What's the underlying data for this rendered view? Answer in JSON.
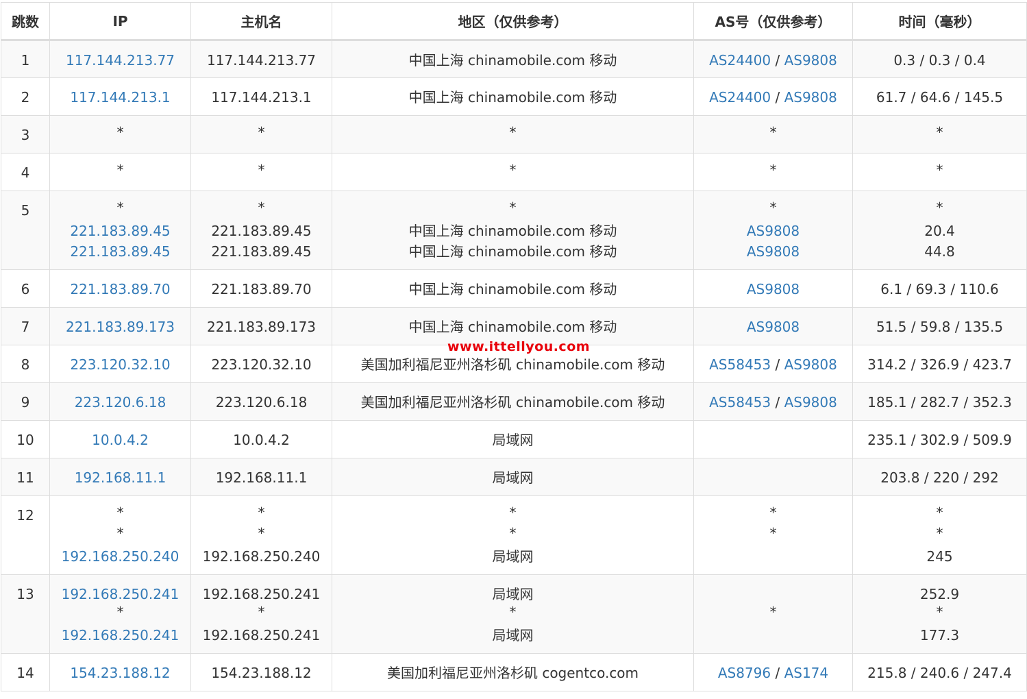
{
  "headers": [
    "跳数",
    "IP",
    "主机名",
    "地区（仅供参考）",
    "AS号（仅供参考）",
    "时间（毫秒）"
  ],
  "rows": [
    {
      "hop": "1",
      "lines": [
        {
          "ip": "117.144.213.77",
          "host": "117.144.213.77",
          "region": "中国上海 chinamobile.com 移动",
          "as": [
            "AS24400",
            "AS9808"
          ],
          "time": "0.3 / 0.3 / 0.4"
        }
      ]
    },
    {
      "hop": "2",
      "lines": [
        {
          "ip": "117.144.213.1",
          "host": "117.144.213.1",
          "region": "中国上海 chinamobile.com 移动",
          "as": [
            "AS24400",
            "AS9808"
          ],
          "time": "61.7 / 64.6 / 145.5"
        }
      ]
    },
    {
      "hop": "3",
      "lines": [
        {
          "ip": "*",
          "host": "*",
          "region": "*",
          "as": [
            "*"
          ],
          "time": "*"
        }
      ]
    },
    {
      "hop": "4",
      "lines": [
        {
          "ip": "*",
          "host": "*",
          "region": "*",
          "as": [
            "*"
          ],
          "time": "*"
        }
      ]
    },
    {
      "hop": "5",
      "lines": [
        {
          "ip": "*",
          "host": "*",
          "region": "*",
          "as": [
            "*"
          ],
          "time": "*"
        },
        {
          "ip": "221.183.89.45",
          "host": "221.183.89.45",
          "region": "中国上海 chinamobile.com 移动",
          "as": [
            "AS9808"
          ],
          "time": "20.4"
        },
        {
          "ip": "221.183.89.45",
          "host": "221.183.89.45",
          "region": "中国上海 chinamobile.com 移动",
          "as": [
            "AS9808"
          ],
          "time": "44.8"
        }
      ]
    },
    {
      "hop": "6",
      "lines": [
        {
          "ip": "221.183.89.70",
          "host": "221.183.89.70",
          "region": "中国上海 chinamobile.com 移动",
          "as": [
            "AS9808"
          ],
          "time": "6.1 / 69.3 / 110.6"
        }
      ]
    },
    {
      "hop": "7",
      "lines": [
        {
          "ip": "221.183.89.173",
          "host": "221.183.89.173",
          "region": "中国上海 chinamobile.com 移动",
          "as": [
            "AS9808"
          ],
          "time": "51.5 / 59.8 / 135.5"
        }
      ]
    },
    {
      "hop": "8",
      "lines": [
        {
          "ip": "223.120.32.10",
          "host": "223.120.32.10",
          "region": "美国加利福尼亚州洛杉矶 chinamobile.com 移动",
          "as": [
            "AS58453",
            "AS9808"
          ],
          "time": "314.2 / 326.9 / 423.7"
        }
      ]
    },
    {
      "hop": "9",
      "lines": [
        {
          "ip": "223.120.6.18",
          "host": "223.120.6.18",
          "region": "美国加利福尼亚州洛杉矶 chinamobile.com 移动",
          "as": [
            "AS58453",
            "AS9808"
          ],
          "time": "185.1 / 282.7 / 352.3"
        }
      ]
    },
    {
      "hop": "10",
      "lines": [
        {
          "ip": "10.0.4.2",
          "host": "10.0.4.2",
          "region": "局域网",
          "as": [],
          "time": "235.1 / 302.9 / 509.9"
        }
      ]
    },
    {
      "hop": "11",
      "lines": [
        {
          "ip": "192.168.11.1",
          "host": "192.168.11.1",
          "region": "局域网",
          "as": [],
          "time": "203.8 / 220 / 292"
        }
      ]
    },
    {
      "hop": "12",
      "lines": [
        {
          "ip": "*",
          "host": "*",
          "region": "*",
          "as": [
            "*"
          ],
          "time": "*"
        },
        {
          "ip": "*",
          "host": "*",
          "region": "*",
          "as": [
            "*"
          ],
          "time": "*"
        },
        {
          "ip": "192.168.250.240",
          "host": "192.168.250.240",
          "region": "局域网",
          "as": [],
          "time": "245"
        }
      ]
    },
    {
      "hop": "13",
      "lines": [
        {
          "ip": "192.168.250.241",
          "host": "192.168.250.241",
          "region": "局域网",
          "as": [],
          "time": "252.9"
        },
        {
          "ip": "*",
          "host": "*",
          "region": "*",
          "as": [
            "*"
          ],
          "time": "*"
        },
        {
          "ip": "192.168.250.241",
          "host": "192.168.250.241",
          "region": "局域网",
          "as": [],
          "time": "177.3"
        }
      ]
    },
    {
      "hop": "14",
      "lines": [
        {
          "ip": "154.23.188.12",
          "host": "154.23.188.12",
          "region": "美国加利福尼亚州洛杉矶 cogentco.com",
          "as": [
            "AS8796",
            "AS174"
          ],
          "time": "215.8 / 240.6 / 247.4"
        }
      ]
    }
  ],
  "as_separator": " / ",
  "watermark": "www.ittellyou.com",
  "colors": {
    "link": "#337ab7",
    "stripe": "#f9f9f9",
    "border": "#dddddd",
    "text": "#333333",
    "watermark": "#e8000b"
  }
}
